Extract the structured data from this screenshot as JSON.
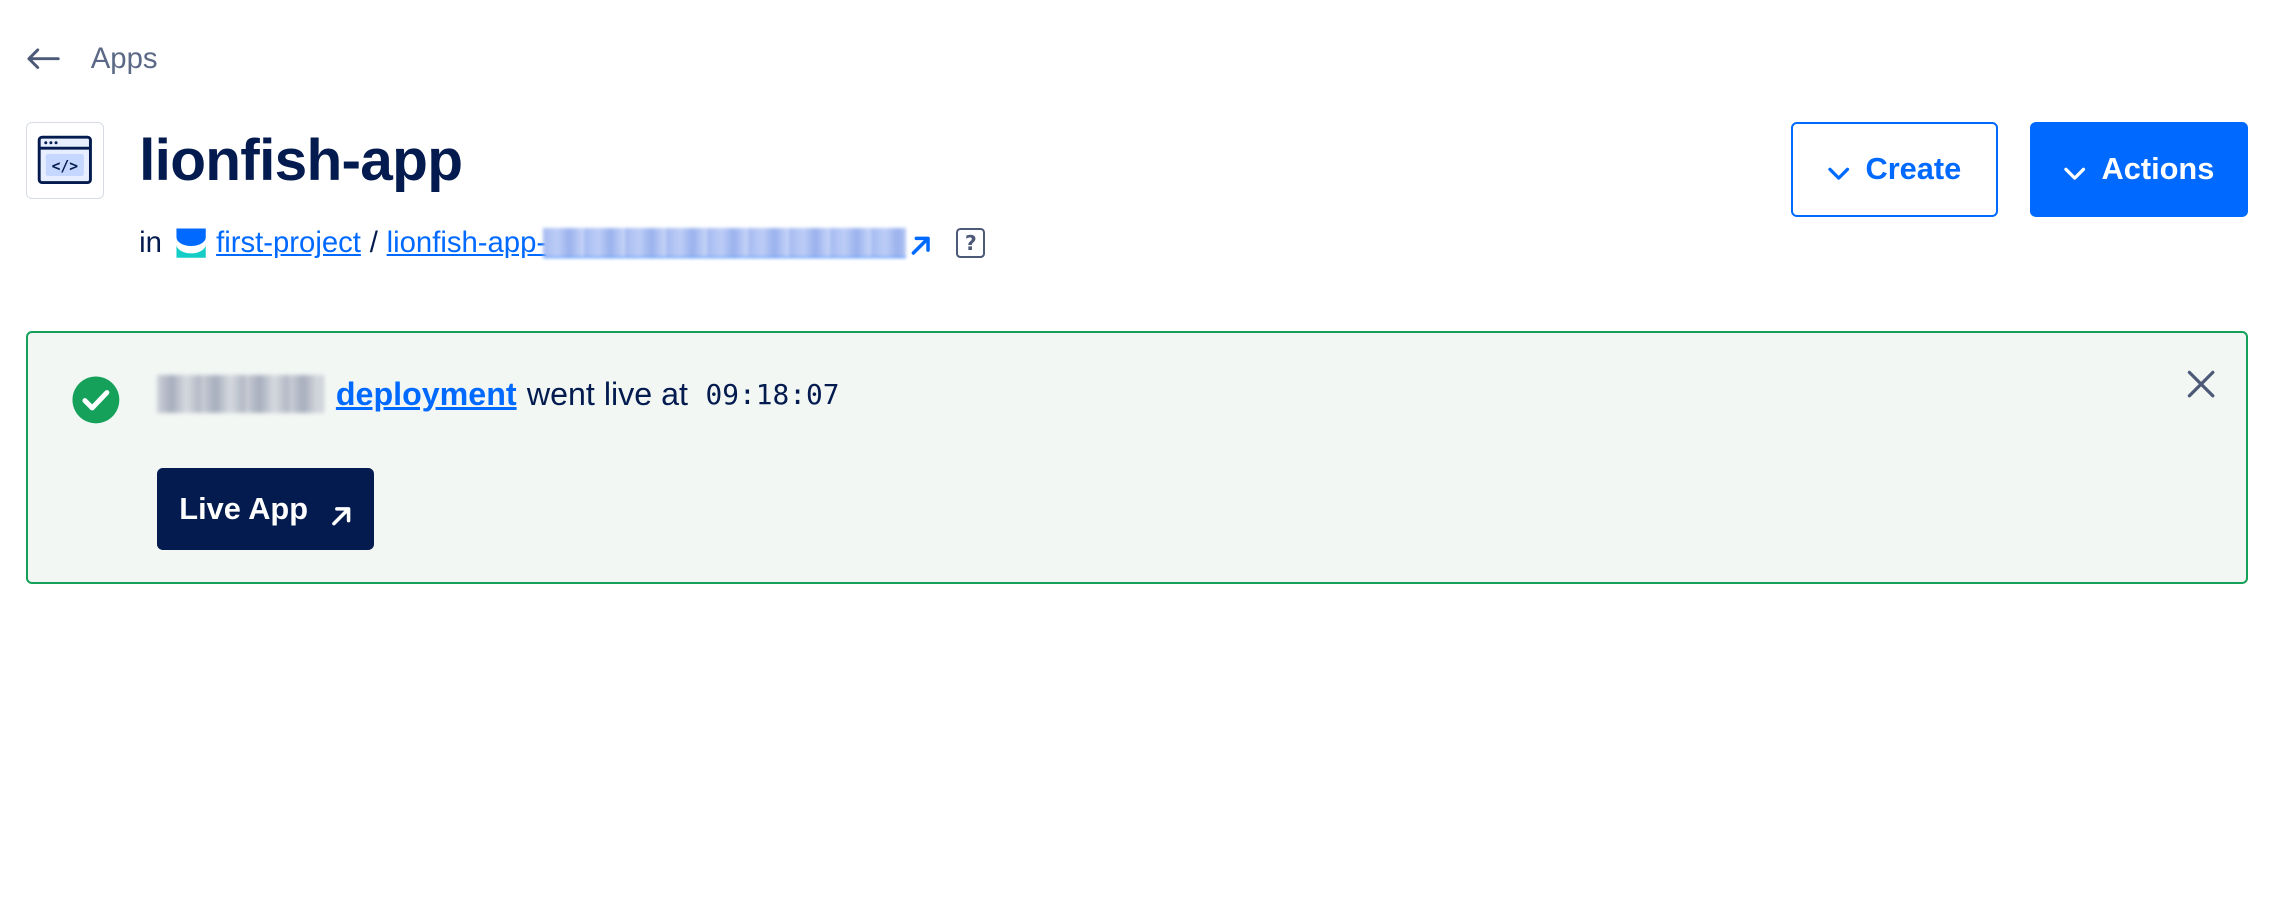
{
  "breadcrumb": {
    "back_icon": "arrow-left-icon",
    "label": "Apps"
  },
  "header": {
    "app_icon": "code-window-icon",
    "title": "lionfish-app",
    "in_label": "in",
    "project_icon": "project-stack-icon",
    "project_link": "first-project",
    "separator": "/",
    "app_link_prefix": "lionfish-app-",
    "external_icon": "external-link-icon",
    "help_label": "?"
  },
  "actions": {
    "create_label": "Create",
    "actions_label": "Actions",
    "chevron_icon": "chevron-down-icon"
  },
  "notice": {
    "status_icon": "check-circle-icon",
    "link_text": "deployment",
    "text": "went live at",
    "time": "09:18:07",
    "close_icon": "close-icon",
    "live_app_label": "Live App",
    "live_app_icon": "arrow-up-right-icon"
  },
  "colors": {
    "primary": "#0069ff",
    "navy": "#031b4e",
    "success": "#15a15a",
    "notice_bg": "#f3f7f4"
  }
}
